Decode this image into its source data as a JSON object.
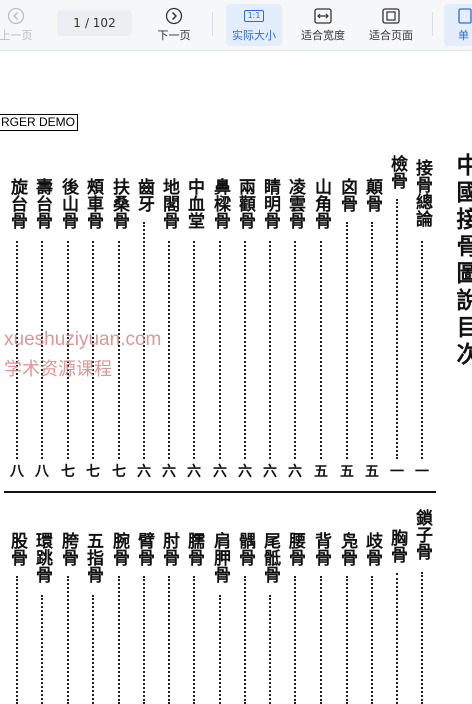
{
  "toolbar": {
    "prev_label": "上一页",
    "page_current": "1",
    "page_total": "/ 102",
    "next_label": "下一页",
    "actual_size_label": "实际大小",
    "actual_size_icon_text": "1:1",
    "fit_width_label": "适合宽度",
    "fit_page_label": "适合页面",
    "single_label": "单"
  },
  "document": {
    "demo_stamp": "RGER DEMO",
    "title": "中國接骨圖說目次",
    "watermark_line1": "xueshuziyuan.com",
    "watermark_line2": "学术资源课程",
    "top_entries": [
      {
        "text": "接骨總論",
        "page": "一"
      },
      {
        "text": "檢骨",
        "page": "一"
      },
      {
        "text": "顛骨",
        "page": "五"
      },
      {
        "text": "囟骨",
        "page": "五"
      },
      {
        "text": "山角骨",
        "page": "五"
      },
      {
        "text": "凌雲骨",
        "page": "六"
      },
      {
        "text": "睛明骨",
        "page": "六"
      },
      {
        "text": "兩顴骨",
        "page": "六"
      },
      {
        "text": "鼻樑骨",
        "page": "六"
      },
      {
        "text": "中血堂",
        "page": "六"
      },
      {
        "text": "地閣骨",
        "page": "六"
      },
      {
        "text": "齒牙",
        "page": "六"
      },
      {
        "text": "扶桑骨",
        "page": "七"
      },
      {
        "text": "頰車骨",
        "page": "七"
      },
      {
        "text": "後山骨",
        "page": "七"
      },
      {
        "text": "壽台骨",
        "page": "八"
      },
      {
        "text": "旋台骨",
        "page": "八"
      }
    ],
    "bottom_entries": [
      "鎖子骨",
      "胸骨",
      "歧骨",
      "凫骨",
      "背骨",
      "腰骨",
      "尾骶骨",
      "髃骨",
      "肩胛骨",
      "臑骨",
      "肘骨",
      "臂骨",
      "腕骨",
      "五指骨",
      "胯骨",
      "環跳骨",
      "股骨"
    ]
  }
}
